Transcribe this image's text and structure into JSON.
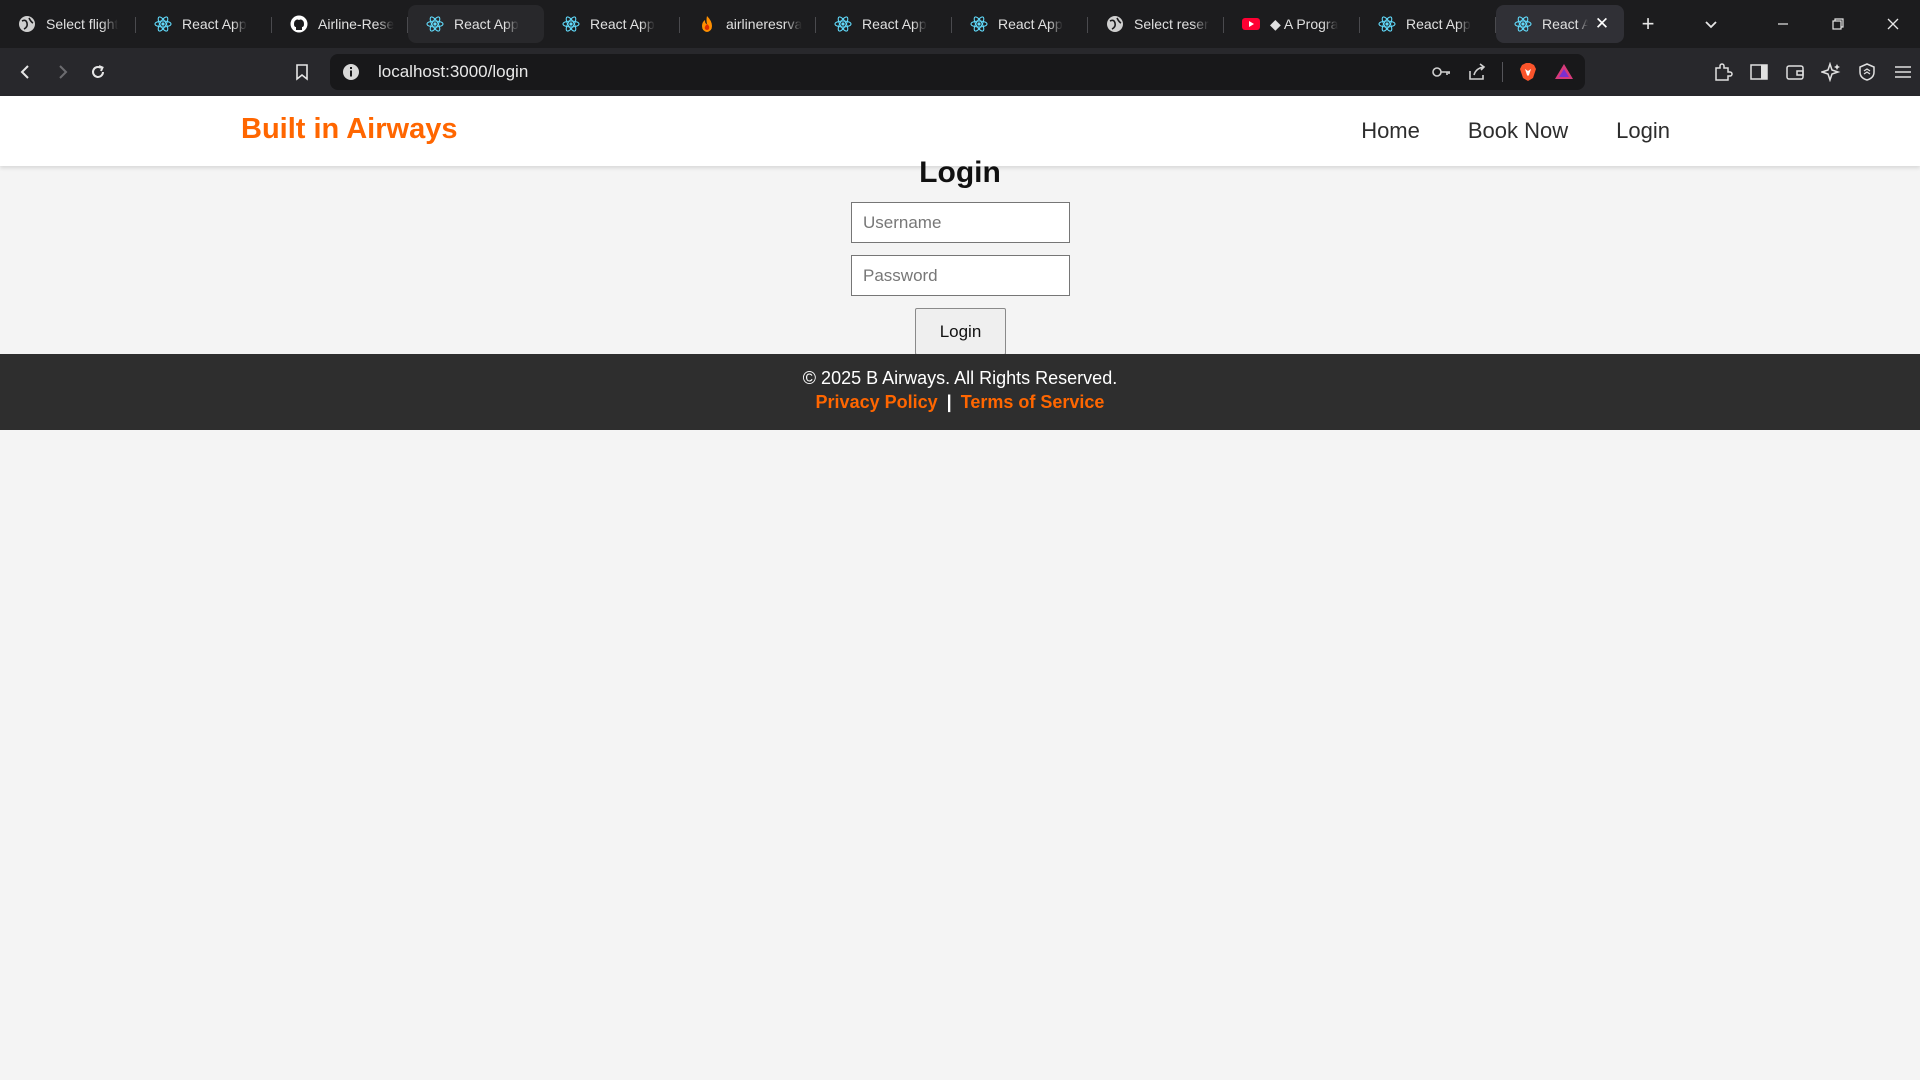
{
  "browser": {
    "tabs": [
      {
        "label": "Select flight",
        "icon": "globe-icon"
      },
      {
        "label": "React App",
        "icon": "react-icon"
      },
      {
        "label": "Airline-Rese",
        "icon": "github-icon"
      },
      {
        "label": "React App",
        "icon": "react-icon"
      },
      {
        "label": "React App",
        "icon": "react-icon"
      },
      {
        "label": "airlineresrva",
        "icon": "firebase-icon"
      },
      {
        "label": "React App",
        "icon": "react-icon"
      },
      {
        "label": "React App",
        "icon": "react-icon"
      },
      {
        "label": "Select reser",
        "icon": "globe-icon"
      },
      {
        "label": "◆ A Progra",
        "icon": "youtube-icon"
      },
      {
        "label": "React App",
        "icon": "react-icon"
      },
      {
        "label": "React A",
        "icon": "react-icon",
        "active": true
      }
    ],
    "url": "localhost:3000/login",
    "colors": {
      "tabbar": "#1c1c1e",
      "toolbar": "#28282c",
      "omnibox": "#18181a"
    }
  },
  "site": {
    "brand": "Built in Airways",
    "nav": {
      "home": "Home",
      "book": "Book Now",
      "login": "Login"
    },
    "colors": {
      "accent": "#ff6600",
      "footer": "#2e2e2e",
      "background": "#f4f4f4"
    }
  },
  "login": {
    "title": "Login",
    "username_placeholder": "Username",
    "password_placeholder": "Password",
    "submit_label": "Login"
  },
  "footer": {
    "copyright": "© 2025 B Airways. All Rights Reserved.",
    "privacy": "Privacy Policy",
    "separator": "|",
    "terms": "Terms of Service"
  }
}
